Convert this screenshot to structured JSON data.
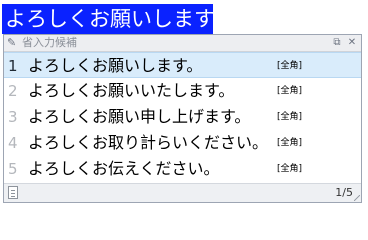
{
  "composition": {
    "text": "よろしくお願いします。"
  },
  "popup": {
    "title": "省入力候補",
    "title_icon": "pin-icon",
    "restore_icon": "restore-icon",
    "close_icon": "close-icon",
    "candidates": [
      {
        "number": "1",
        "text": "よろしくお願いします。",
        "tag": "[全角]"
      },
      {
        "number": "2",
        "text": "よろしくお願いいたします。",
        "tag": "[全角]"
      },
      {
        "number": "3",
        "text": "よろしくお願い申し上げます。",
        "tag": "[全角]"
      },
      {
        "number": "4",
        "text": "よろしくお取り計らいください。",
        "tag": "[全角]"
      },
      {
        "number": "5",
        "text": "よろしくお伝えください。",
        "tag": "[全角]"
      }
    ],
    "selected_index": 0,
    "status": {
      "page": "1/5",
      "icon": "document-icon"
    }
  },
  "colors": {
    "composition_bg": "#0a22ff",
    "selected_row_bg": "#d9ecfb"
  }
}
